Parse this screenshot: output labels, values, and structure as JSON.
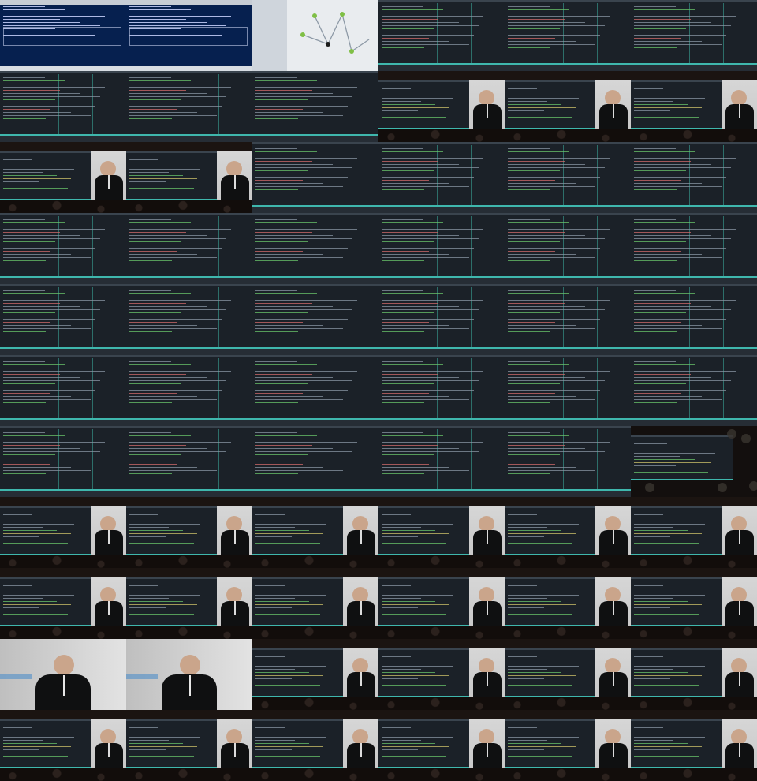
{
  "sheet": {
    "columns": 6,
    "rows": 11,
    "frames": [
      "blue",
      "blue",
      "diagram",
      "terminal",
      "terminal",
      "terminal",
      "terminal",
      "terminal",
      "terminal",
      "speaker",
      "speaker",
      "speaker",
      "speaker",
      "speaker",
      "terminal",
      "terminal",
      "terminal",
      "terminal",
      "terminal",
      "terminal",
      "terminal",
      "terminal",
      "terminal",
      "terminal",
      "terminal",
      "terminal",
      "terminal",
      "terminal",
      "terminal",
      "terminal",
      "terminal",
      "terminal",
      "terminal",
      "terminal",
      "terminal",
      "terminal",
      "terminal",
      "terminal",
      "terminal",
      "terminal",
      "terminal",
      "stage",
      "speaker",
      "speaker",
      "speaker",
      "speaker",
      "speaker",
      "speaker",
      "speaker",
      "speaker",
      "speaker",
      "speaker",
      "speaker",
      "speaker",
      "speakerfull",
      "speakerfull",
      "speaker",
      "speaker",
      "speaker",
      "speaker",
      "speaker",
      "speaker",
      "speaker",
      "speaker",
      "speaker",
      "speaker"
    ]
  },
  "colors": {
    "terminal_bg": "#1b2128",
    "accent_teal": "#3fb7ad",
    "blue_terminal_bg": "#06204f",
    "stage_bg": "#130f0e",
    "diagram_bg": "#e9ecef"
  }
}
